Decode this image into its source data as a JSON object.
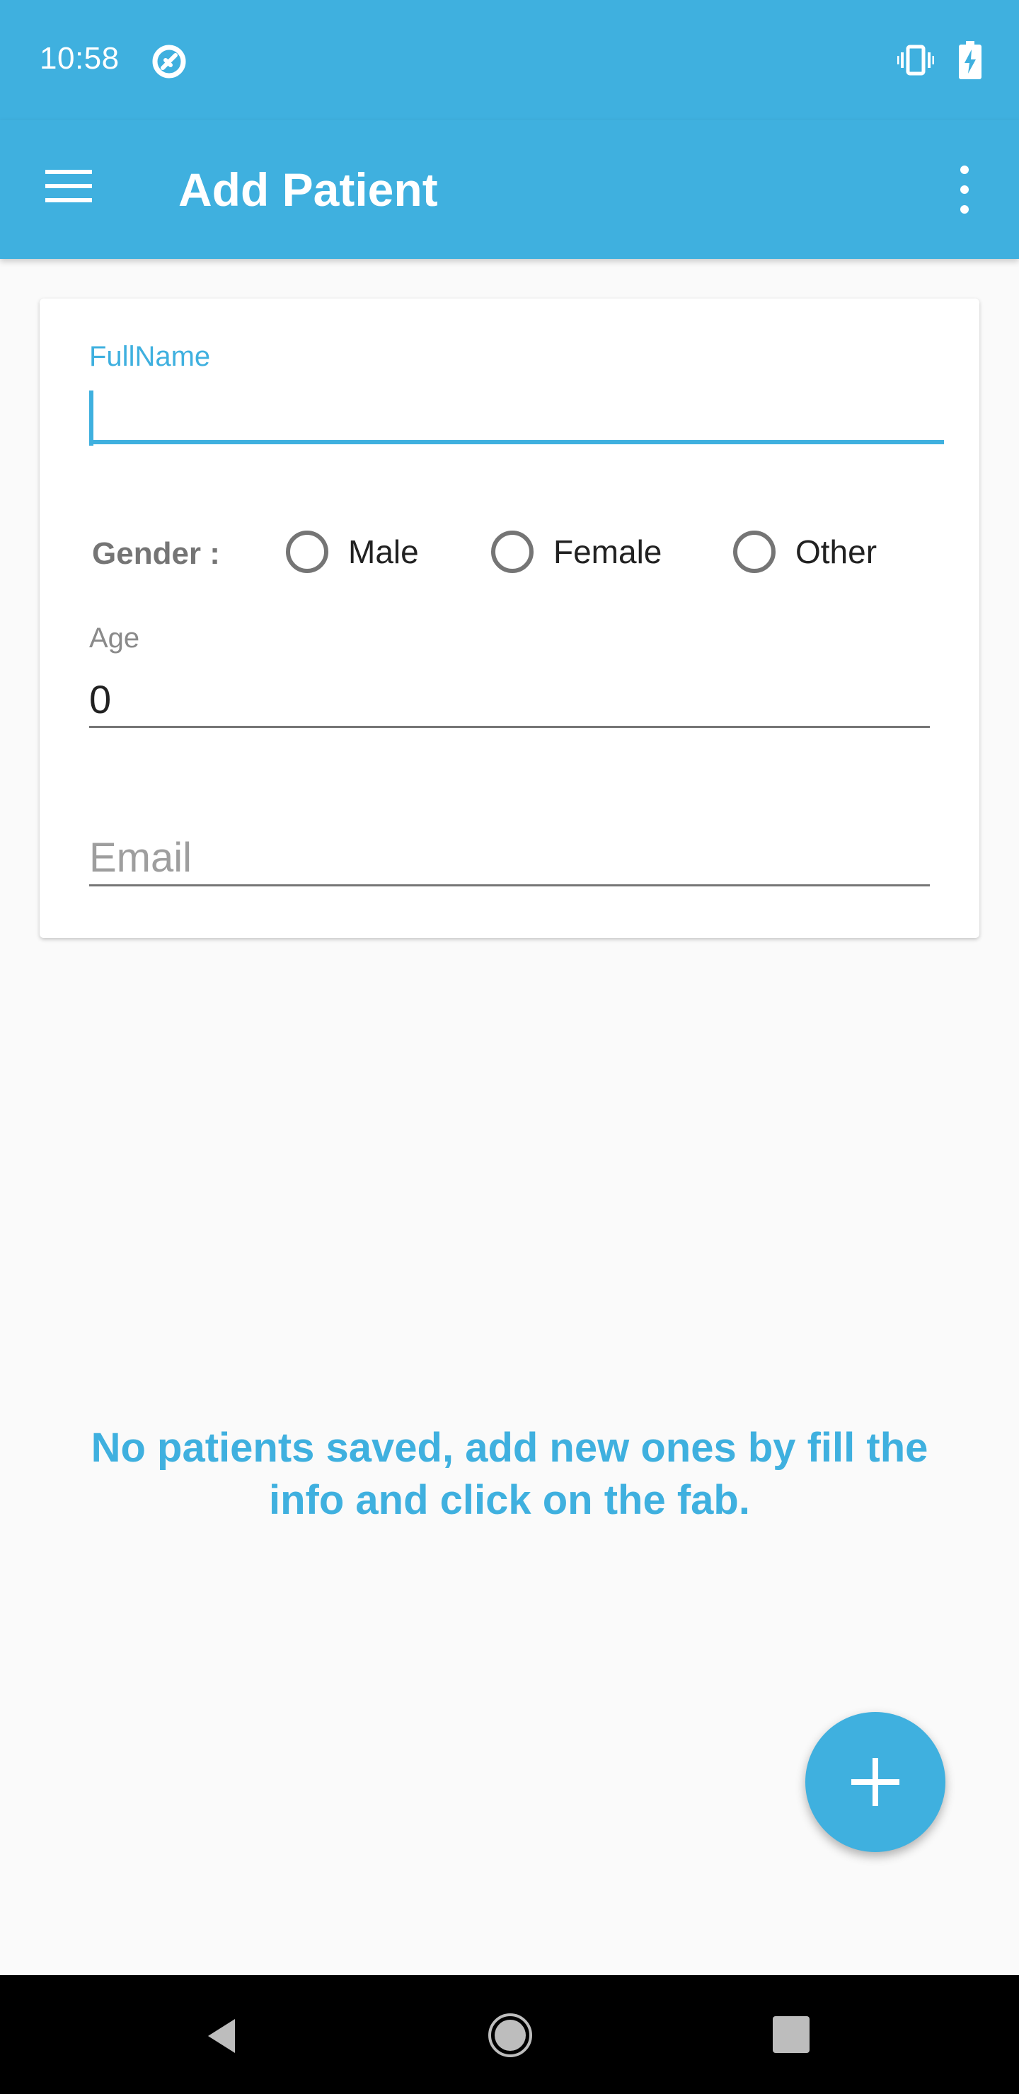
{
  "status_bar": {
    "time": "10:58",
    "icons": [
      "notification-icon",
      "vibrate-icon",
      "battery-charging-icon"
    ]
  },
  "app_bar": {
    "title": "Add Patient",
    "icons": [
      "menu-icon",
      "more-vert-icon"
    ]
  },
  "form": {
    "fullname": {
      "label": "FullName",
      "value": ""
    },
    "gender": {
      "label": "Gender :",
      "options": [
        "Male",
        "Female",
        "Other"
      ],
      "selected": null
    },
    "age": {
      "label": "Age",
      "value": "0"
    },
    "email": {
      "placeholder": "Email",
      "value": ""
    }
  },
  "empty_state": {
    "message": "No patients saved, add new ones by fill the info and click on the fab."
  },
  "fab": {
    "icon": "plus-icon"
  },
  "navigation_bar": {
    "icons": [
      "back-icon",
      "home-icon",
      "recents-icon"
    ]
  },
  "colors": {
    "primary": "#3fb0df",
    "background": "#fafafa",
    "card": "#ffffff",
    "nav_bar": "#000000"
  }
}
